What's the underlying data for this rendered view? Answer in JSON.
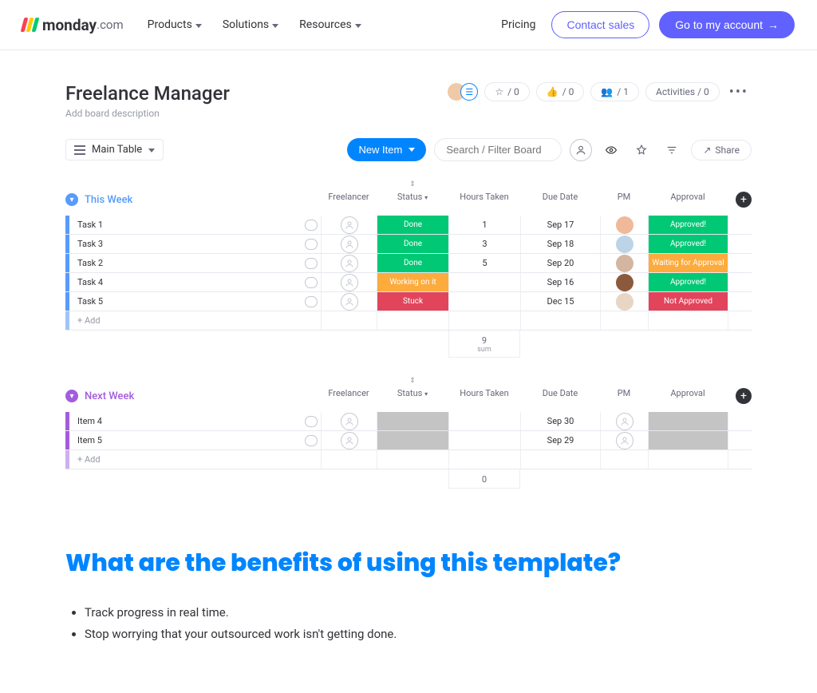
{
  "nav": {
    "products": "Products",
    "solutions": "Solutions",
    "resources": "Resources",
    "pricing": "Pricing",
    "contact": "Contact sales",
    "account": "Go to my account"
  },
  "board": {
    "title": "Freelance Manager",
    "desc": "Add board description",
    "stars": "/ 0",
    "likes": "/ 0",
    "members": "/ 1",
    "activities": "Activities / 0",
    "mainTable": "Main Table",
    "newItem": "New Item",
    "searchPlaceholder": "Search / Filter Board",
    "share": "Share"
  },
  "columns": {
    "freelancer": "Freelancer",
    "status": "Status",
    "hours": "Hours Taken",
    "due": "Due Date",
    "pm": "PM",
    "approval": "Approval"
  },
  "groups": [
    {
      "name": "This Week",
      "colorClass": "blue",
      "rows": [
        {
          "task": "Task 1",
          "status": "Done",
          "statusClass": "st-green",
          "hours": "1",
          "due": "Sep 17",
          "pmColor": "#f0b99a",
          "approval": "Approved!",
          "appClass": "ap-green"
        },
        {
          "task": "Task 3",
          "status": "Done",
          "statusClass": "st-green",
          "hours": "3",
          "due": "Sep 18",
          "pmColor": "#bcd4e6",
          "approval": "Approved!",
          "appClass": "ap-green"
        },
        {
          "task": "Task 2",
          "status": "Done",
          "statusClass": "st-green",
          "hours": "5",
          "due": "Sep 20",
          "pmColor": "#d4b5a0",
          "approval": "Waiting for Approval",
          "appClass": "ap-orange"
        },
        {
          "task": "Task 4",
          "status": "Working on it",
          "statusClass": "st-orange",
          "hours": "",
          "due": "Sep 16",
          "pmColor": "#8b5a3c",
          "approval": "Approved!",
          "appClass": "ap-green"
        },
        {
          "task": "Task 5",
          "status": "Stuck",
          "statusClass": "st-red",
          "hours": "",
          "due": "Dec 15",
          "pmColor": "#e8d5c4",
          "approval": "Not Approved",
          "appClass": "ap-red"
        }
      ],
      "addLabel": "+ Add",
      "sum": "9",
      "sumLabel": "sum"
    },
    {
      "name": "Next Week",
      "colorClass": "purple",
      "rows": [
        {
          "task": "Item 4",
          "status": "",
          "statusClass": "st-grey",
          "hours": "",
          "due": "Sep 30",
          "pmColor": "",
          "approval": "",
          "appClass": "ap-grey"
        },
        {
          "task": "Item 5",
          "status": "",
          "statusClass": "st-grey",
          "hours": "",
          "due": "Sep 29",
          "pmColor": "",
          "approval": "",
          "appClass": "ap-grey"
        }
      ],
      "addLabel": "+ Add",
      "sum": "0",
      "sumLabel": ""
    }
  ],
  "article": {
    "heading": "What are the benefits of using this template?",
    "bullets": [
      "Track progress in real time.",
      "Stop worrying that your outsourced work isn't getting done."
    ]
  },
  "logoText": "monday",
  "logoSuffix": ".com"
}
